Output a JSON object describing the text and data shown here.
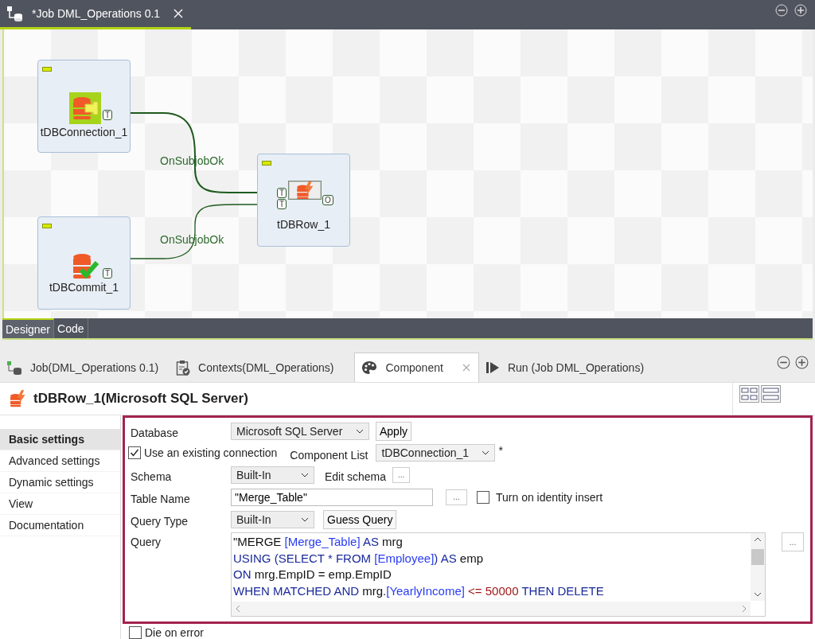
{
  "editor_tab": {
    "title": "*Job DML_Operations 0.1"
  },
  "canvas": {
    "nodes": [
      {
        "label": "tDBConnection_1",
        "kind": "connection",
        "selected": false,
        "ports": [
          {
            "label": "T",
            "kind": "out"
          }
        ]
      },
      {
        "label": "tDBRow_1",
        "kind": "row",
        "selected": true,
        "ports": [
          {
            "label": "T",
            "kind": "in"
          },
          {
            "label": "T",
            "kind": "in"
          },
          {
            "label": "O",
            "kind": "out"
          }
        ]
      },
      {
        "label": "tDBCommit_1",
        "kind": "commit",
        "selected": false,
        "ports": [
          {
            "label": "T",
            "kind": "out"
          }
        ]
      }
    ],
    "links": [
      {
        "label": "OnSubjobOk"
      },
      {
        "label": "OnSubjobOk"
      }
    ]
  },
  "view_tabs": [
    {
      "label": "Designer",
      "selected": true
    },
    {
      "label": "Code",
      "selected": false
    }
  ],
  "panel_tabs": [
    {
      "label": "Job(DML_Operations 0.1)",
      "kind": "job",
      "selected": false
    },
    {
      "label": "Contexts(DML_Operations)",
      "kind": "contexts",
      "selected": false
    },
    {
      "label": "Component",
      "kind": "component",
      "selected": true
    },
    {
      "label": "Run (Job DML_Operations)",
      "kind": "run",
      "selected": false
    }
  ],
  "component_title": "tDBRow_1(Microsoft SQL Server)",
  "sidebar": [
    {
      "label": "Basic settings",
      "selected": true
    },
    {
      "label": "Advanced settings",
      "selected": false
    },
    {
      "label": "Dynamic settings",
      "selected": false
    },
    {
      "label": "View",
      "selected": false
    },
    {
      "label": "Documentation",
      "selected": false
    }
  ],
  "form": {
    "database": {
      "label": "Database",
      "value": "Microsoft SQL Server",
      "apply": "Apply"
    },
    "use_existing": {
      "label": "Use an existing connection",
      "checked": true
    },
    "component_list": {
      "label": "Component List",
      "value": "tDBConnection_1",
      "required_mark": "*"
    },
    "schema": {
      "label": "Schema",
      "value": "Built-In",
      "edit_label": "Edit schema",
      "more": "..."
    },
    "table_name": {
      "label": "Table Name",
      "value": "\"Merge_Table\"",
      "more": "...",
      "identity_insert": {
        "label": "Turn on identity insert",
        "checked": false
      }
    },
    "query_type": {
      "label": "Query Type",
      "value": "Built-In",
      "guess": "Guess Query"
    },
    "query": {
      "label": "Query",
      "more": "...",
      "lines": [
        [
          {
            "text": "\"MERGE ",
            "kind": "plain"
          },
          {
            "text": "[Merge_Table]",
            "kind": "ident"
          },
          {
            "text": " AS ",
            "kind": "keyword"
          },
          {
            "text": "mrg",
            "kind": "plain"
          }
        ],
        [
          {
            "text": "USING (",
            "kind": "keyword"
          },
          {
            "text": "SELECT * FROM ",
            "kind": "keyword"
          },
          {
            "text": "[Employee]",
            "kind": "ident"
          },
          {
            "text": ") AS ",
            "kind": "keyword"
          },
          {
            "text": "emp",
            "kind": "plain"
          }
        ],
        [
          {
            "text": "ON ",
            "kind": "keyword"
          },
          {
            "text": "mrg.EmpID = emp.EmpID",
            "kind": "plain"
          }
        ],
        [
          {
            "text": "WHEN MATCHED AND ",
            "kind": "keyword"
          },
          {
            "text": "mrg.",
            "kind": "plain"
          },
          {
            "text": "[YearlyIncome]",
            "kind": "ident"
          },
          {
            "text": " <= 50000",
            "kind": "number"
          },
          {
            "text": " THEN DELETE",
            "kind": "keyword"
          }
        ]
      ]
    }
  },
  "die_on_error": {
    "label": "Die on error",
    "checked": false
  }
}
